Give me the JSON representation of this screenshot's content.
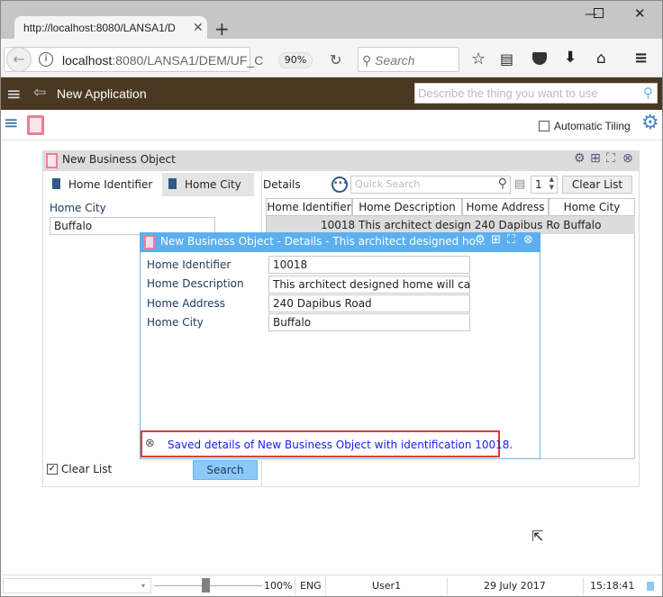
{
  "browser": {
    "tab_title": "http://localhost:8080/LANSA1/D",
    "url_host": "localhost",
    "url_rest": ":8080/LANSA1/DEM/UF_C",
    "zoom": "90%",
    "search_placeholder": "Search"
  },
  "app": {
    "title": "New Application",
    "search_placeholder": "Describe the thing you want to use",
    "automatic_tiling": "Automatic Tiling"
  },
  "panel": {
    "title": "New Business Object",
    "tabs": [
      {
        "label": "Home Identifier"
      },
      {
        "label": "Home City"
      }
    ],
    "field_label": "Home City",
    "field_value": "Buffalo",
    "clear_list_check": "Clear List",
    "search_button": "Search",
    "details_label": "Details",
    "quick_search_placeholder": "Quick Search",
    "page_value": "1",
    "clear_list_button": "Clear List",
    "columns": [
      "Home Identifier",
      "Home Description",
      "Home Address",
      "Home City"
    ],
    "rows": [
      [
        "10018",
        "This architect design",
        "240 Dapibus Ro",
        "Buffalo"
      ]
    ]
  },
  "popup": {
    "title": "New Business Object - Details - This architect designed ho...",
    "fields": [
      {
        "label": "Home Identifier",
        "value": "10018"
      },
      {
        "label": "Home Description",
        "value": "This architect designed home will capti"
      },
      {
        "label": "Home Address",
        "value": "240 Dapibus Road"
      },
      {
        "label": "Home City",
        "value": "Buffalo"
      }
    ],
    "message": "Saved details of New Business Object with identification 10018."
  },
  "status": {
    "zoom": "100%",
    "lang": "ENG",
    "user": "User1",
    "date": "29 July 2017",
    "time": "15:18:41"
  },
  "colors": {
    "appbar": "#4a3822",
    "popup_title": "#5cb0f0",
    "message": "#1a1aff",
    "highlight": "#e53935"
  }
}
